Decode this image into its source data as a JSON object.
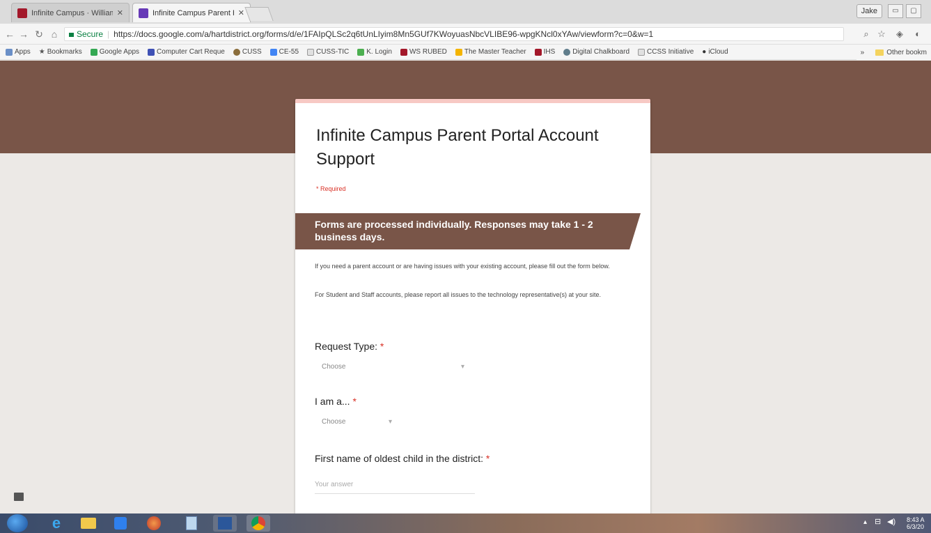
{
  "browser": {
    "tabs": [
      {
        "label": "Infinite Campus · William",
        "active": false,
        "favicon": "infinite-campus-icon"
      },
      {
        "label": "Infinite Campus Parent P",
        "active": true,
        "favicon": "google-forms-icon"
      }
    ],
    "user_label": "Jake",
    "secure_label": "Secure",
    "url": "https://docs.google.com/a/hartdistrict.org/forms/d/e/1FAIpQLSc2q6tUnLIyim8Mn5GUf7KWoyuasNbcVLIBE96-wpgKNcl0xYAw/viewform?c=0&w=1",
    "bookmarks": [
      "Apps",
      "Bookmarks",
      "Google Apps",
      "Computer Cart Reque",
      "CUSS",
      "CE-55",
      "CUSS-TIC",
      "K. Login",
      "WS RUBED",
      "The Master Teacher",
      "IHS",
      "Digital Chalkboard",
      "CCSS Initiative",
      "iCloud"
    ],
    "other_bookmarks": "Other bookm"
  },
  "form": {
    "title": "Infinite Campus Parent Portal Account Support",
    "required_note": "* Required",
    "section_title": "Forms are processed individually. Responses may take 1 - 2 business days.",
    "description_1": "If you need a parent account or are having issues with your existing account, please fill out the form below.",
    "description_2": "For Student and Staff accounts, please report all issues to the technology representative(s) at your site.",
    "questions": [
      {
        "label": "Request Type:",
        "required_mark": "*",
        "placeholder": "Choose"
      },
      {
        "label": "I am a...",
        "required_mark": "*",
        "placeholder": "Choose"
      },
      {
        "label": "First name of oldest child in the district:",
        "required_mark": "*",
        "placeholder": "Your answer"
      }
    ]
  },
  "taskbar": {
    "clock_time": "8:43 A",
    "clock_date": "6/3/20"
  },
  "colors": {
    "banner": "#795548",
    "accent_top": "#f7c9c4",
    "required": "#d93025"
  }
}
